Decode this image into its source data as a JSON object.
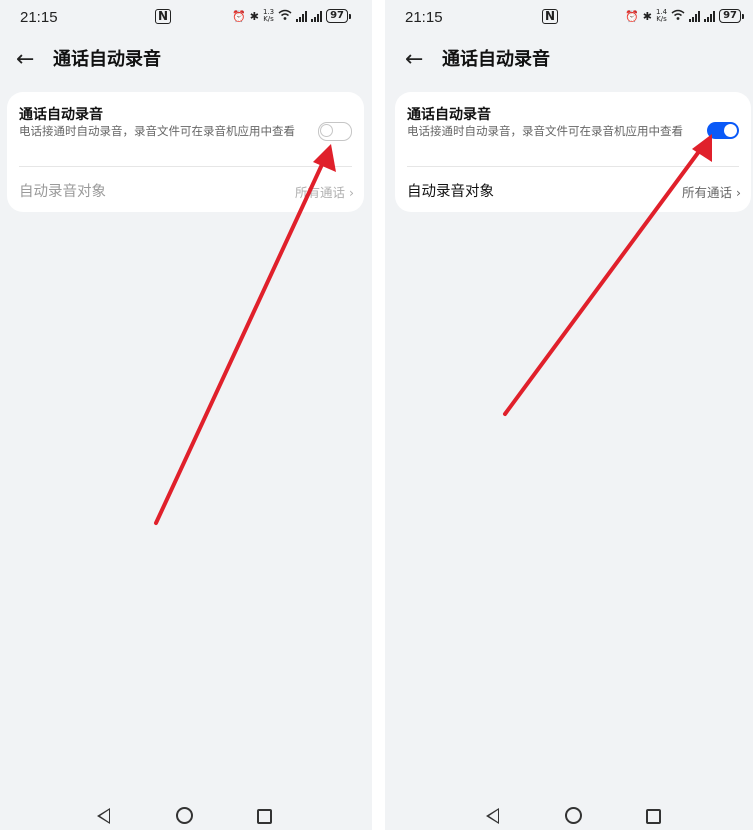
{
  "screens": [
    {
      "status": {
        "time": "21:15",
        "nfc": "N",
        "speed_top": "1.3",
        "speed_bottom": "K/s",
        "battery": "97"
      },
      "header": {
        "back_glyph": "←",
        "title": "通话自动录音"
      },
      "setting": {
        "title": "通话自动录音",
        "description": "电话接通时自动录音，录音文件可在录音机应用中查看",
        "toggle_state": "off",
        "target_label": "自动录音对象",
        "target_value": "所有通话",
        "target_enabled": false,
        "chevron": "›"
      }
    },
    {
      "status": {
        "time": "21:15",
        "nfc": "N",
        "speed_top": "1.4",
        "speed_bottom": "K/s",
        "battery": "97"
      },
      "header": {
        "back_glyph": "←",
        "title": "通话自动录音"
      },
      "setting": {
        "title": "通话自动录音",
        "description": "电话接通时自动录音，录音文件可在录音机应用中查看",
        "toggle_state": "on",
        "target_label": "自动录音对象",
        "target_value": "所有通话",
        "target_enabled": true,
        "chevron": "›"
      }
    }
  ],
  "colors": {
    "accent": "#0a59f7",
    "annotation_arrow": "#e0202b",
    "background": "#f1f3f5"
  }
}
